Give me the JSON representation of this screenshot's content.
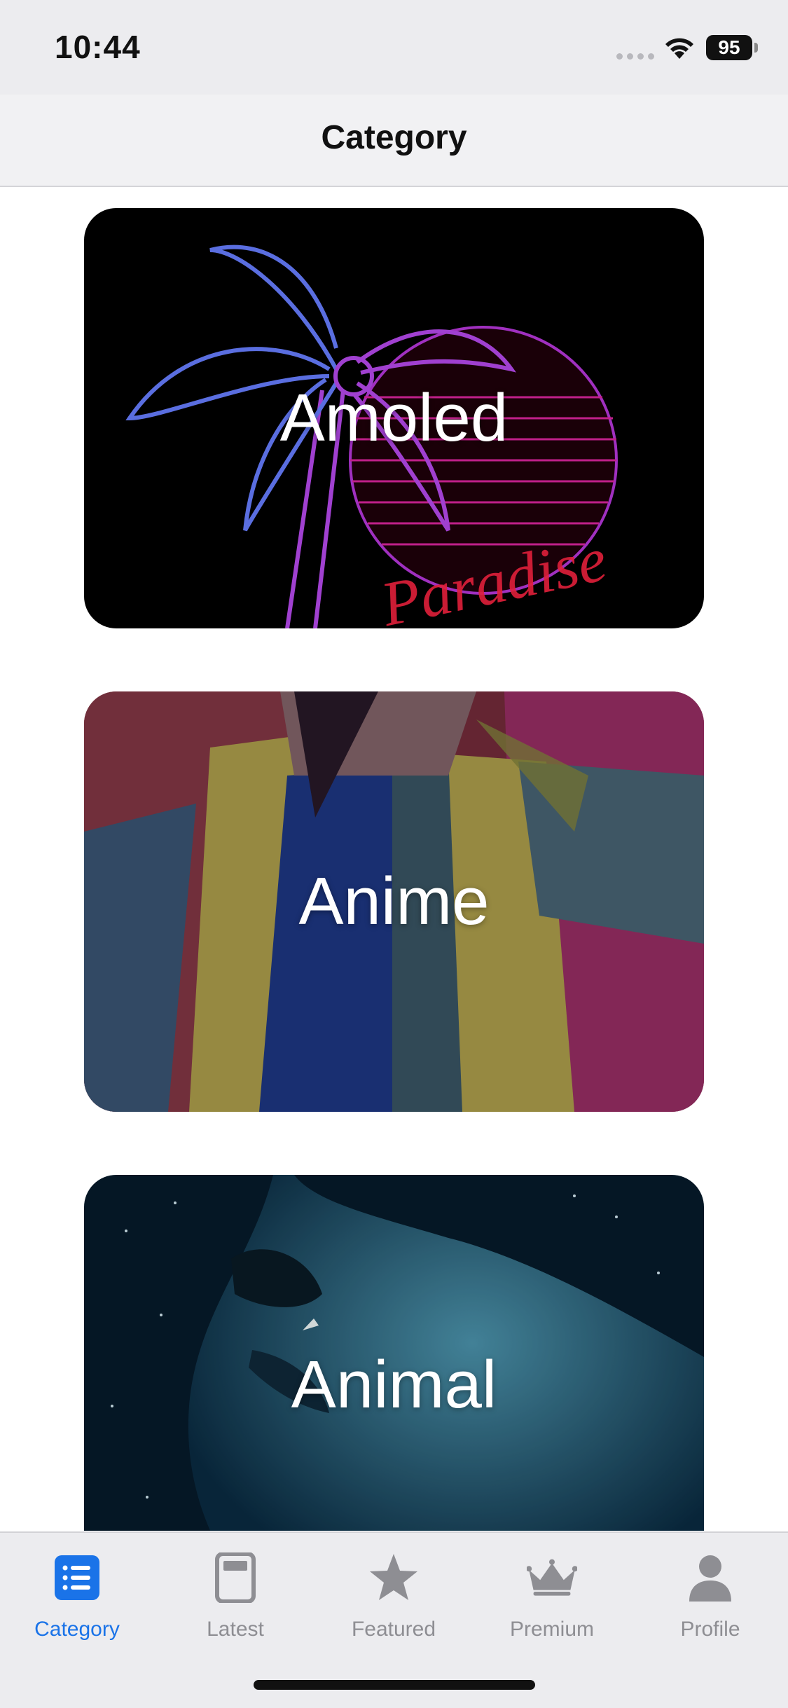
{
  "status_bar": {
    "time": "10:44",
    "battery": "95"
  },
  "nav": {
    "title": "Category"
  },
  "categories": [
    {
      "label": "Amoled"
    },
    {
      "label": "Anime"
    },
    {
      "label": "Animal"
    }
  ],
  "tabs": [
    {
      "label": "Category",
      "icon": "list-icon",
      "active": true
    },
    {
      "label": "Latest",
      "icon": "tablet-icon",
      "active": false
    },
    {
      "label": "Featured",
      "icon": "star-icon",
      "active": false
    },
    {
      "label": "Premium",
      "icon": "crown-icon",
      "active": false
    },
    {
      "label": "Profile",
      "icon": "person-icon",
      "active": false
    }
  ],
  "colors": {
    "accent": "#1a73e8",
    "inactive": "#8e8e93"
  }
}
